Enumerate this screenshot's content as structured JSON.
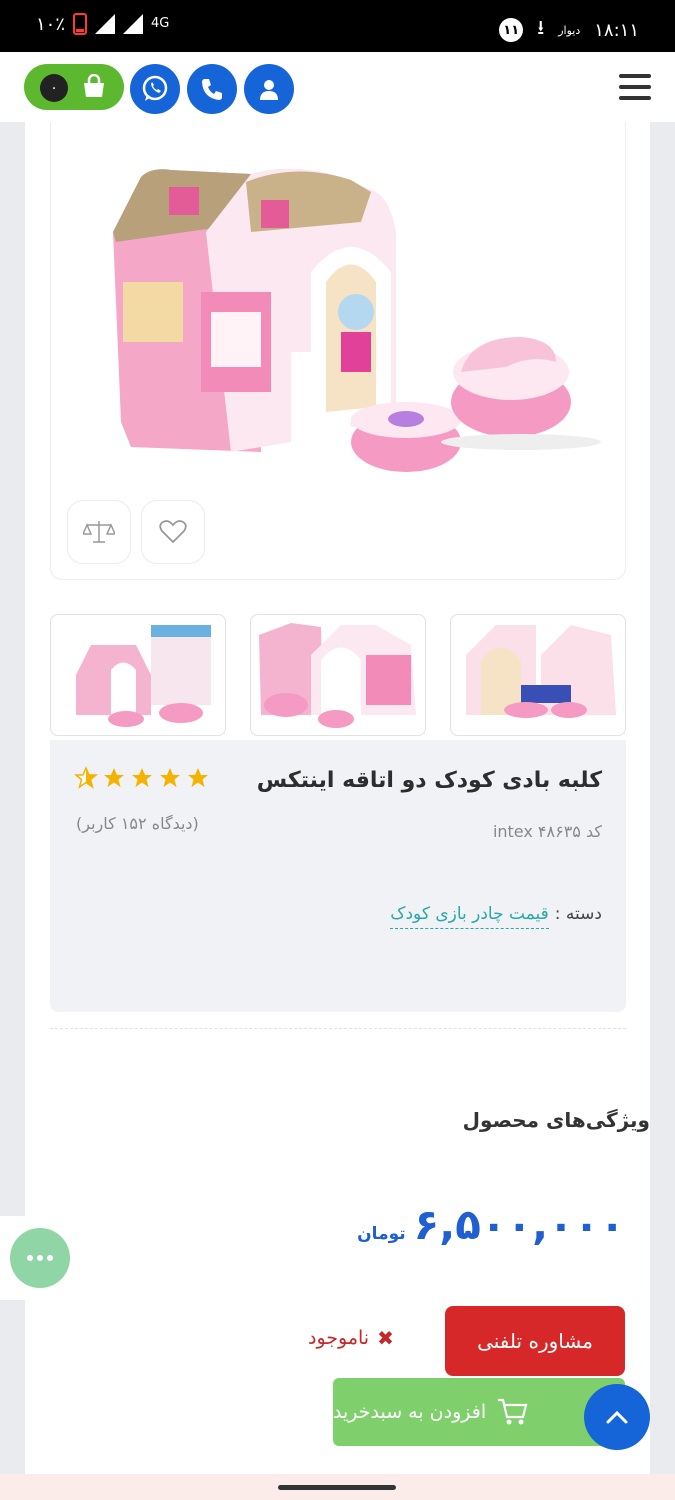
{
  "status_bar": {
    "time": "۱۸:۱۱",
    "app_label": "دیوار",
    "notification_count": "۱۱",
    "network": "4G",
    "battery": "۱۰٪"
  },
  "header": {
    "cart_count": "۰"
  },
  "product": {
    "title": "کلبه بادی کودک دو اتاقه اینتکس",
    "rating": 4.5,
    "views": "(دیدگاه ۱۵۲ کاربر)",
    "code": "کد intex ۴۸۶۳۵",
    "category_label": "دسته :",
    "category_value": "قیمت چادر بازی کودک"
  },
  "sections": {
    "features_title": "ویژگی‌های محصول"
  },
  "price": {
    "value": "۶,۵۰۰,۰۰۰",
    "currency": "تومان"
  },
  "actions": {
    "consult": "مشاوره تلفنی",
    "out_of_stock": "ناموجود",
    "add_to_cart": "افزودن به سبدخرید"
  },
  "colors": {
    "primary_blue": "#1565d8",
    "green": "#5cb82e",
    "red": "#d62828",
    "price_blue": "#1f5fd1",
    "link_teal": "#2aa8a8"
  }
}
